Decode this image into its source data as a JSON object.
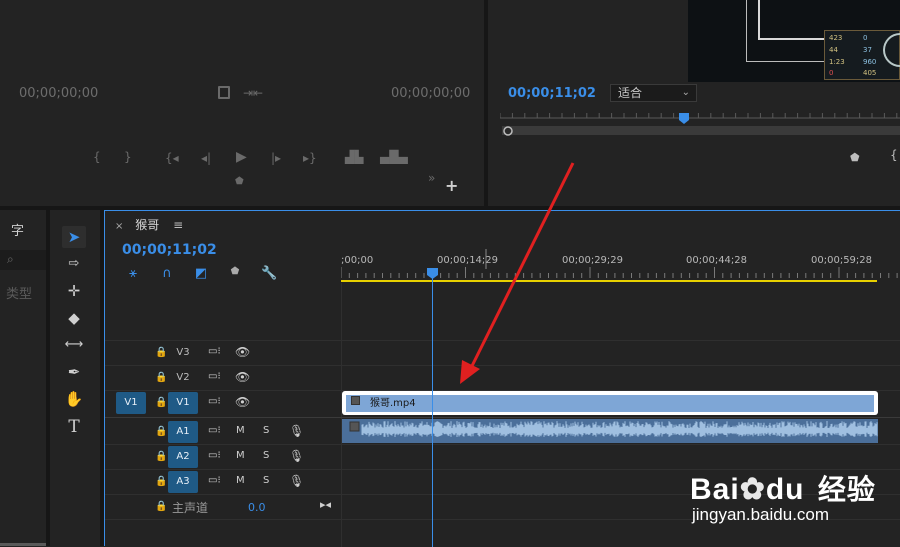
{
  "source_monitor": {
    "tc_left": "00;00;00;00",
    "tc_right": "00;00;00;00"
  },
  "program_monitor": {
    "timecode": "00;00;11;02",
    "fit_option": "适合",
    "hud": {
      "r1a": "423",
      "r1b": "0",
      "r2a": "44",
      "r2b": "37",
      "r3a": "1:23",
      "r3b": "960",
      "r4a": "0",
      "r4b": "405"
    }
  },
  "left_panel": {
    "tab_char": "字",
    "type_label": "类型"
  },
  "timeline": {
    "sequence_name": "猴哥",
    "timecode": "00;00;11;02",
    "ruler_labels": [
      ";00;00",
      "00;00;14;29",
      "00;00;29;29",
      "00;00;44;28",
      "00;00;59;28"
    ],
    "tracks": {
      "v3": "V3",
      "v2": "V2",
      "v1_source": "V1",
      "v1": "V1",
      "a1": "A1",
      "a2": "A2",
      "a3": "A3"
    },
    "mute": "M",
    "solo": "S",
    "master_label": "主声道",
    "master_value": "0.0",
    "video_clip_name": "猴哥.mp4"
  },
  "watermark": {
    "brand_latin": "Bai",
    "brand_latin2": "du",
    "brand_cn": "经验",
    "url": "jingyan.baidu.com"
  },
  "colors": {
    "accent": "#3a8ee8",
    "clip_video": "#7ea6d6",
    "clip_audio": "#4b6f9a",
    "arrow": "#e02020",
    "workarea": "#e8d000"
  }
}
